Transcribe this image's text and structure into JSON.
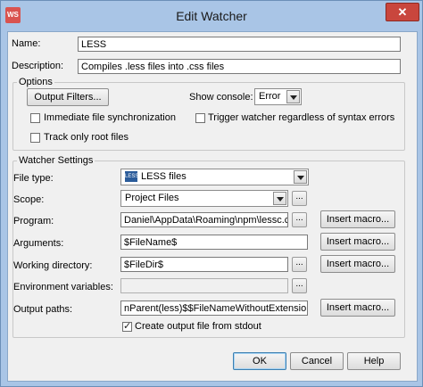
{
  "window": {
    "title": "Edit Watcher",
    "close_glyph": "✕"
  },
  "name": {
    "label": "Name:",
    "value": "LESS"
  },
  "description": {
    "label": "Description:",
    "value": "Compiles .less files into .css files"
  },
  "options": {
    "title": "Options",
    "output_filters_button": "Output Filters...",
    "show_console_label": "Show console:",
    "show_console_value": "Error",
    "immediate_sync_label": "Immediate file synchronization",
    "immediate_sync_checked": false,
    "trigger_label": "Trigger watcher regardless of syntax errors",
    "trigger_checked": false,
    "track_root_label": "Track only root files",
    "track_root_checked": false
  },
  "watcher_settings": {
    "title": "Watcher Settings",
    "file_type_label": "File type:",
    "file_type_value": "LESS files",
    "file_type_icon": "less-file-icon",
    "scope_label": "Scope:",
    "scope_value": "Project Files",
    "program_label": "Program:",
    "program_value": "Daniel\\AppData\\Roaming\\npm\\lessc.cmd",
    "arguments_label": "Arguments:",
    "arguments_value": "$FileName$",
    "working_dir_label": "Working directory:",
    "working_dir_value": "$FileDir$",
    "env_vars_label": "Environment variables:",
    "env_vars_value": "",
    "output_paths_label": "Output paths:",
    "output_paths_value": "nParent(less)$$FileNameWithoutExtension$.css",
    "create_output_label": "Create output file from stdout",
    "create_output_checked": true,
    "insert_macro": "Insert macro...",
    "browse_glyph": "..."
  },
  "footer": {
    "ok": "OK",
    "cancel": "Cancel",
    "help": "Help"
  }
}
